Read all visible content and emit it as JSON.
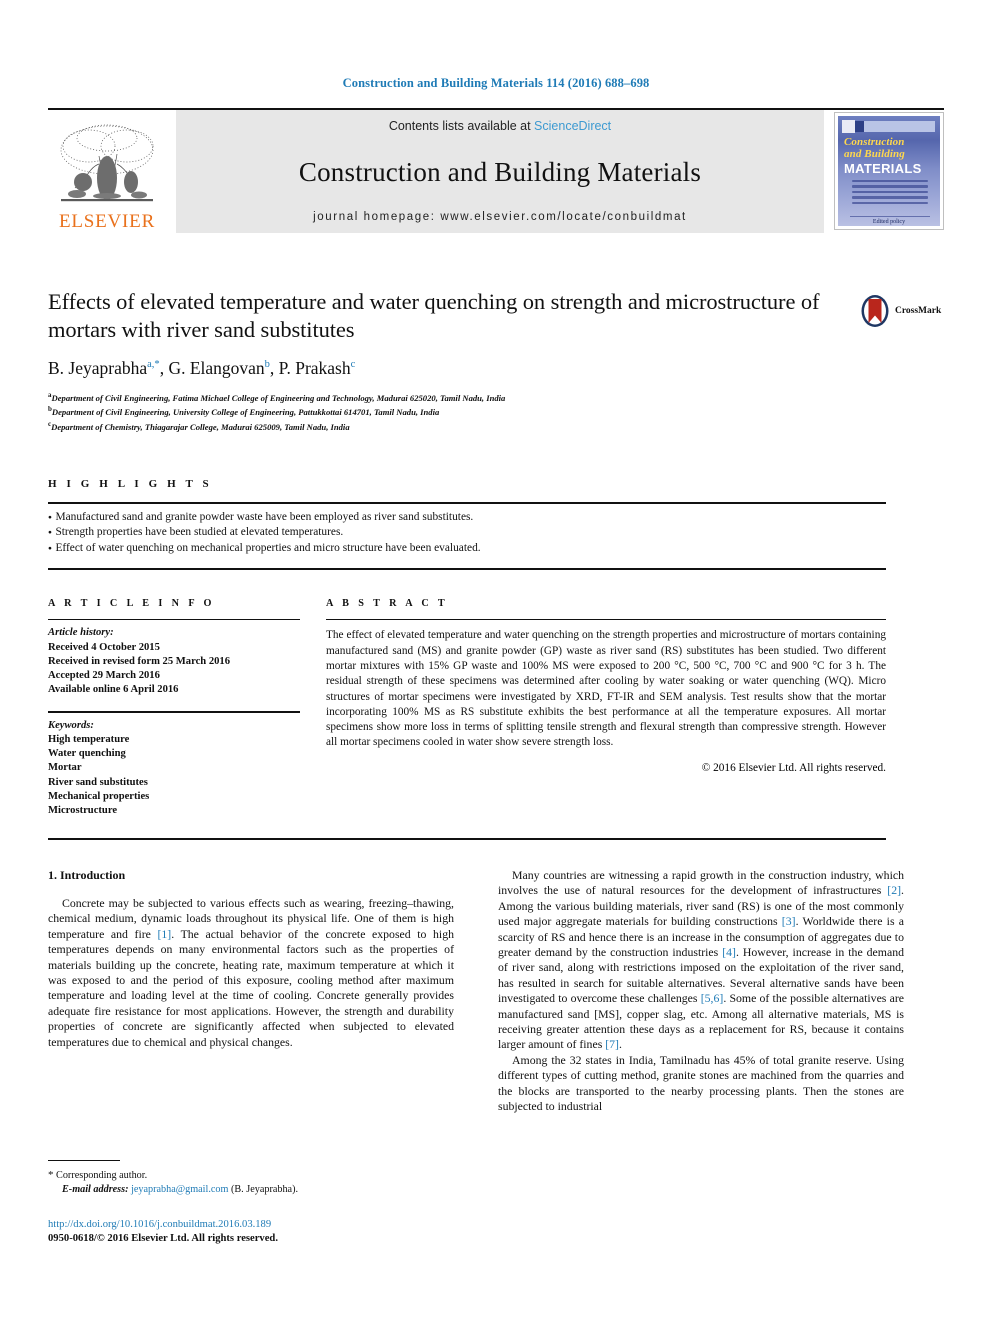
{
  "running_head": "Construction and Building Materials 114 (2016) 688–698",
  "masthead": {
    "publisher_logo_text": "ELSEVIER",
    "contents_line_prefix": "Contents lists available at ",
    "contents_line_link": "ScienceDirect",
    "journal_title": "Construction and Building Materials",
    "homepage_line": "journal homepage: www.elsevier.com/locate/conbuildmat",
    "cover": {
      "line1": "Construction",
      "line2": "and Building",
      "line3": "MATERIALS",
      "footer": "Edited policy"
    }
  },
  "article": {
    "title": "Effects of elevated temperature and water quenching on strength and microstructure of mortars with river sand substitutes",
    "crossmark_label": "CrossMark",
    "authors": [
      {
        "name": "B. Jeyaprabha",
        "marks": "a,*"
      },
      {
        "name": "G. Elangovan",
        "marks": "b"
      },
      {
        "name": "P. Prakash",
        "marks": "c"
      }
    ],
    "affiliations": [
      {
        "mark": "a",
        "text": "Department of Civil Engineering, Fatima Michael College of Engineering and Technology, Madurai 625020, Tamil Nadu, India"
      },
      {
        "mark": "b",
        "text": "Department of Civil Engineering, University College of Engineering, Pattukkottai 614701, Tamil Nadu, India"
      },
      {
        "mark": "c",
        "text": "Department of Chemistry, Thiagarajar College, Madurai 625009, Tamil Nadu, India"
      }
    ]
  },
  "highlights": {
    "heading": "H I G H L I G H T S",
    "items": [
      "Manufactured sand and granite powder waste have been employed as river sand substitutes.",
      "Strength properties have been studied at elevated temperatures.",
      "Effect of water quenching on mechanical properties and micro structure have been evaluated."
    ]
  },
  "article_info": {
    "heading": "A R T I C L E    I N F O",
    "history_label": "Article history:",
    "history": [
      "Received 4 October 2015",
      "Received in revised form 25 March 2016",
      "Accepted 29 March 2016",
      "Available online 6 April 2016"
    ],
    "keywords_label": "Keywords:",
    "keywords": [
      "High temperature",
      "Water quenching",
      "Mortar",
      "River sand substitutes",
      "Mechanical properties",
      "Microstructure"
    ]
  },
  "abstract": {
    "heading": "A B S T R A C T",
    "text": "The effect of elevated temperature and water quenching on the strength properties and microstructure of mortars containing manufactured sand (MS) and granite powder (GP) waste as river sand (RS) substitutes has been studied. Two different mortar mixtures with 15% GP waste and 100% MS were exposed to 200 °C, 500 °C, 700 °C and 900 °C for 3 h. The residual strength of these specimens was determined after cooling by water soaking or water quenching (WQ). Micro structures of mortar specimens were investigated by XRD, FT-IR and SEM analysis. Test results show that the mortar incorporating 100% MS as RS substitute exhibits the best performance at all the temperature exposures. All mortar specimens show more loss in terms of splitting tensile strength and flexural strength than compressive strength. However all mortar specimens cooled in water show severe strength loss.",
    "copyright": "© 2016 Elsevier Ltd. All rights reserved."
  },
  "introduction": {
    "section_title": "1. Introduction",
    "left_paragraphs": [
      "Concrete may be subjected to various effects such as wearing, freezing–thawing, chemical medium, dynamic loads throughout its physical life. One of them is high temperature and fire [1]. The actual behavior of the concrete exposed to high temperatures depends on many environmental factors such as the properties of materials building up the concrete, heating rate, maximum temperature at which it was exposed to and the period of this exposure, cooling method after maximum temperature and loading level at the time of cooling. Concrete generally provides adequate fire resistance for most applications. However, the strength and durability properties of concrete are significantly affected when subjected to elevated temperatures due to chemical and physical changes."
    ],
    "right_paragraphs": [
      "Many countries are witnessing a rapid growth in the construction industry, which involves the use of natural resources for the development of infrastructures [2]. Among the various building materials, river sand (RS) is one of the most commonly used major aggregate materials for building constructions [3]. Worldwide there is a scarcity of RS and hence there is an increase in the consumption of aggregates due to greater demand by the construction industries [4]. However, increase in the demand of river sand, along with restrictions imposed on the exploitation of the river sand, has resulted in search for suitable alternatives. Several alternative sands have been investigated to overcome these challenges [5,6]. Some of the possible alternatives are manufactured sand [MS], copper slag, etc. Among all alternative materials, MS is receiving greater attention these days as a replacement for RS, because it contains larger amount of fines [7].",
      "Among the 32 states in India, Tamilnadu has 45% of total granite reserve. Using different types of cutting method, granite stones are machined from the quarries and the blocks are transported to the nearby processing plants. Then the stones are subjected to industrial"
    ]
  },
  "footnote": {
    "corresponding_star": "*",
    "corresponding_label": "Corresponding author.",
    "email_label": "E-mail address:",
    "email": "jeyaprabha@gmail.com",
    "email_owner": "(B. Jeyaprabha).",
    "doi_url": "http://dx.doi.org/10.1016/j.conbuildmat.2016.03.189",
    "issn_line": "0950-0618/© 2016 Elsevier Ltd. All rights reserved."
  },
  "colors": {
    "link_blue": "#1f7bb6",
    "sciencedirect_blue": "#3d9ad1",
    "elsevier_orange": "#E9711C",
    "banner_grey": "#e7e7e7",
    "cover_yellow": "#ffd84d"
  }
}
